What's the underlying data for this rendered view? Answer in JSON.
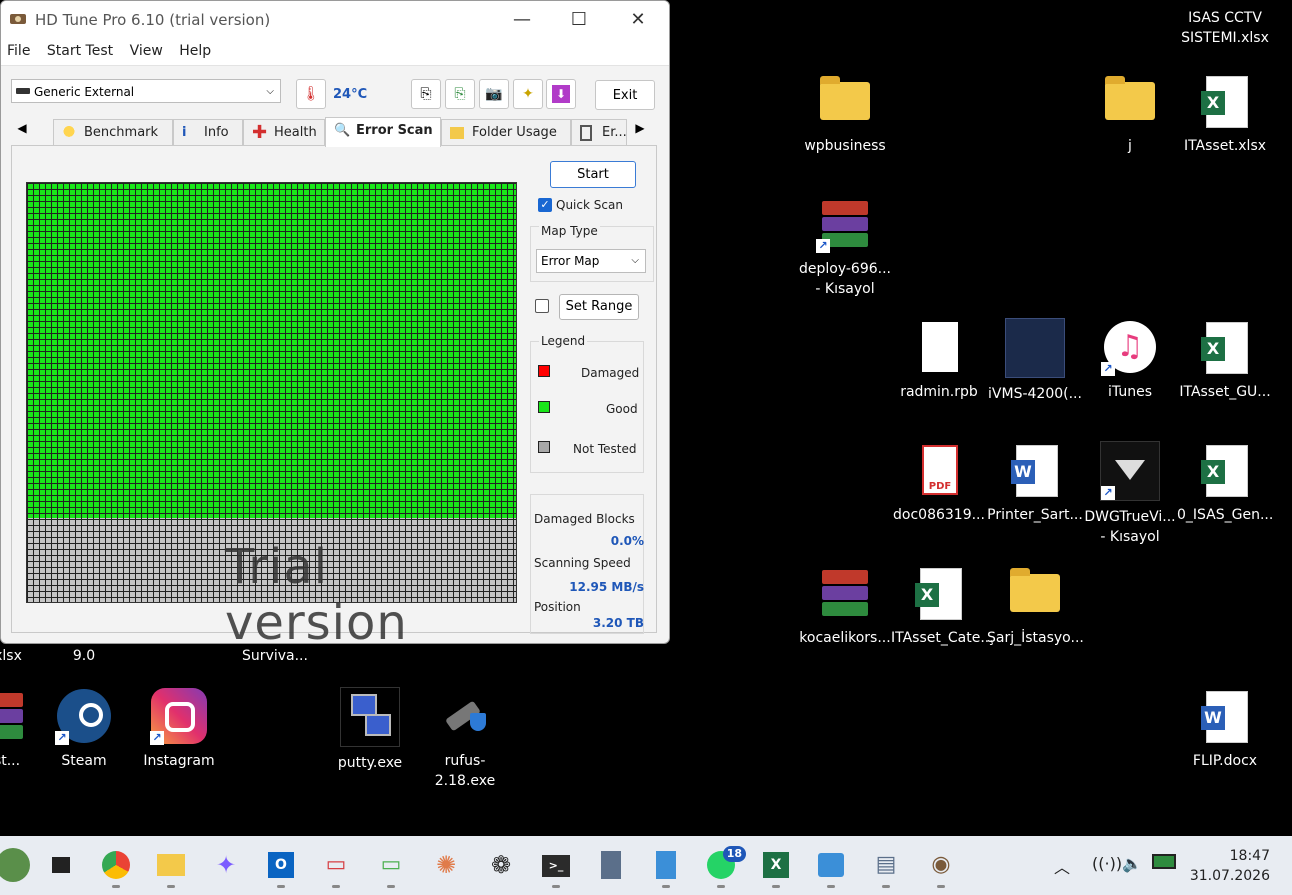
{
  "window": {
    "title": "HD Tune Pro 6.10 (trial version)",
    "menu": [
      "File",
      "Start Test",
      "View",
      "Help"
    ],
    "drive": "Generic External",
    "temperature": "24°C",
    "exit_label": "Exit",
    "tabs": [
      "Benchmark",
      "Info",
      "Health",
      "Error Scan",
      "Folder Usage",
      "Er..."
    ],
    "active_tab": "Error Scan",
    "start_label": "Start",
    "quick_scan_label": "Quick Scan",
    "quick_scan_checked": true,
    "map_type_label": "Map Type",
    "map_type_value": "Error Map",
    "set_range_label": "Set Range",
    "legend_title": "Legend",
    "legend": [
      {
        "label": "Damaged",
        "color": "#ff0000"
      },
      {
        "label": "Good",
        "color": "#19e619"
      },
      {
        "label": "Not Tested",
        "color": "#a8a8a8"
      }
    ],
    "damaged_blocks_label": "Damaged Blocks",
    "damaged_blocks_value": "0.0%",
    "scanning_speed_label": "Scanning Speed",
    "scanning_speed_value": "12.95 MB/s",
    "position_label": "Position",
    "position_value": "3.20 TB",
    "watermark": "Trial version",
    "scan_progress_fraction": 0.8
  },
  "desktop_icons": [
    {
      "label": "ISAS CCTV\nSISTEMI.xlsx",
      "type": "none"
    },
    {
      "label": "wpbusiness",
      "type": "folder"
    },
    {
      "label": "j",
      "type": "folder"
    },
    {
      "label": "ITAsset.xlsx",
      "type": "excel"
    },
    {
      "label": "deploy-696...\n- Kısayol",
      "type": "rar"
    },
    {
      "label": "radmin.rpb",
      "type": "doc"
    },
    {
      "label": "iVMS-4200(...",
      "type": "app"
    },
    {
      "label": "iTunes",
      "type": "itunes"
    },
    {
      "label": "ITAsset_GU...",
      "type": "excel"
    },
    {
      "label": "doc086319...",
      "type": "pdf"
    },
    {
      "label": "Printer_Sart...",
      "type": "word"
    },
    {
      "label": "DWGTrueVi...\n- Kısayol",
      "type": "dwg"
    },
    {
      "label": "0_ISAS_Gen...",
      "type": "excel"
    },
    {
      "label": "kocaelikors...",
      "type": "rar"
    },
    {
      "label": "ITAsset_Cate...",
      "type": "excel"
    },
    {
      "label": "Şarj_İstasyo...",
      "type": "folder"
    },
    {
      "label": "FLIP.docx",
      "type": "word"
    },
    {
      "label": "rest...",
      "type": "rar"
    },
    {
      "label": "Steam",
      "type": "steam"
    },
    {
      "label": "Instagram",
      "type": "instagram"
    },
    {
      "label": "putty.exe",
      "type": "putty"
    },
    {
      "label": "rufus-2.18.exe",
      "type": "rufus"
    }
  ],
  "partial_labels": [
    "xlsx",
    "9.0",
    "Surviva..."
  ],
  "taskbar": {
    "whatsapp_badge": "18",
    "time": "18:47",
    "date": "31.07.2026"
  }
}
